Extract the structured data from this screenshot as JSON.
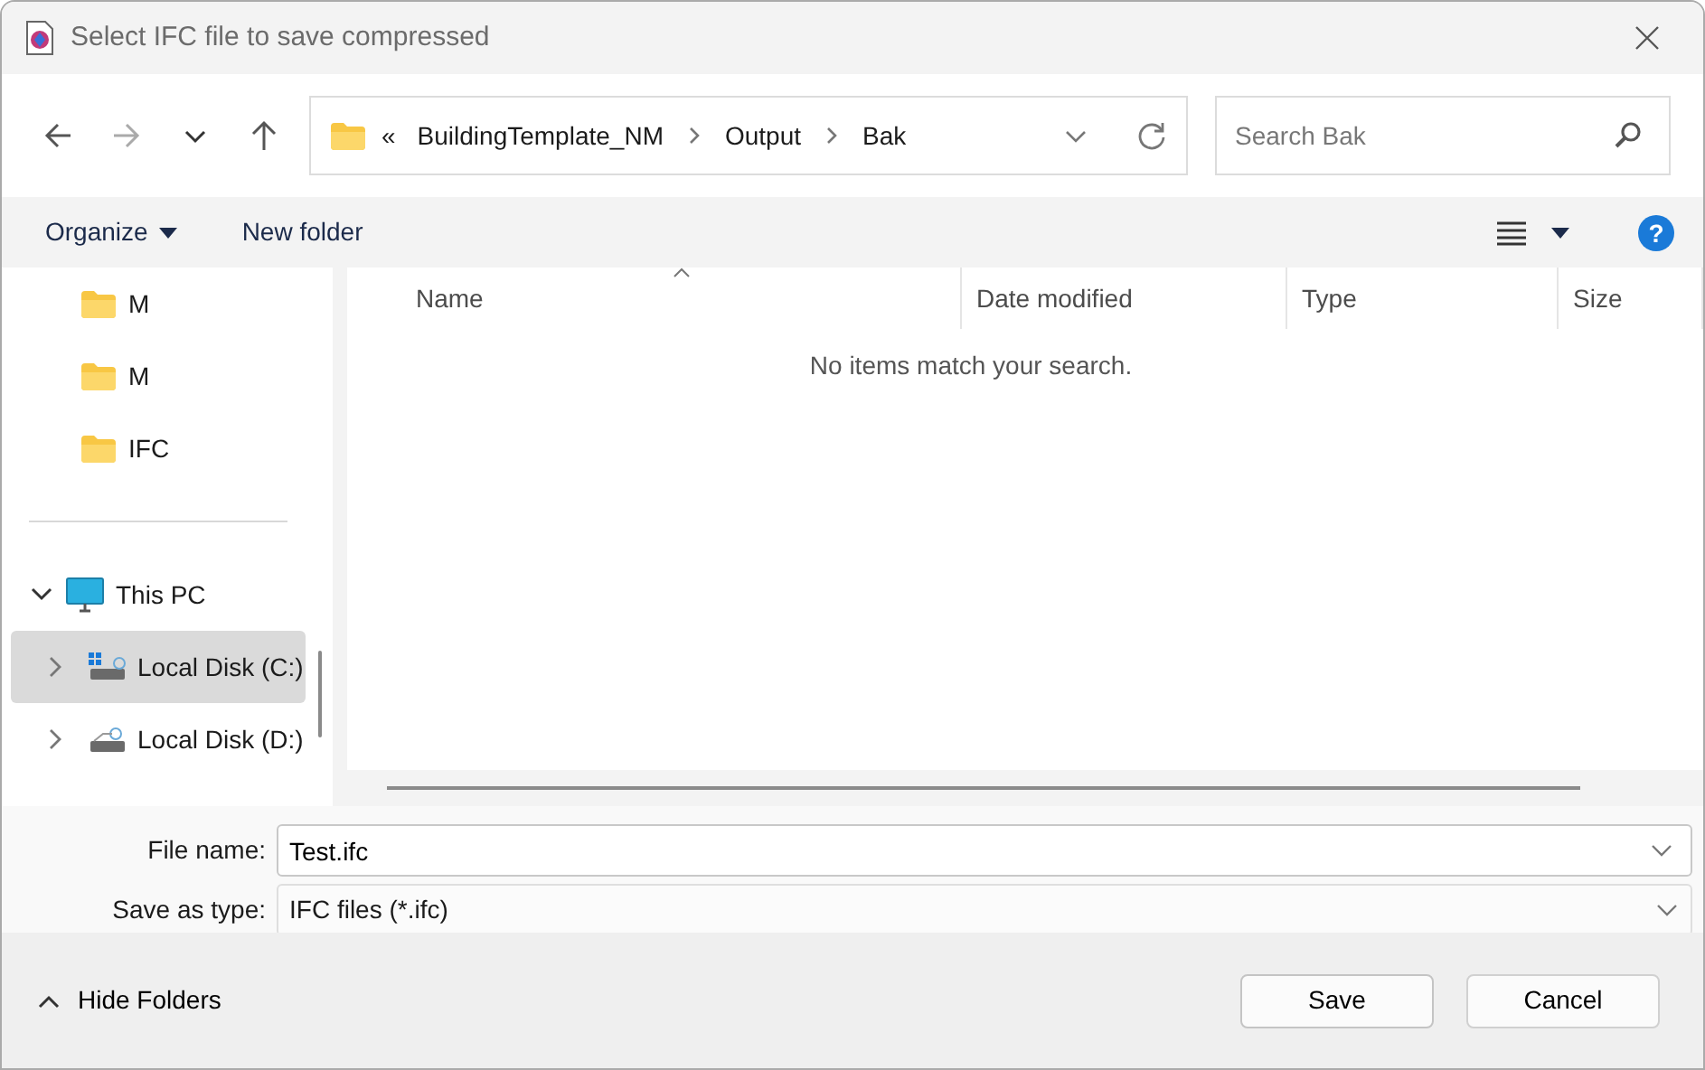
{
  "window": {
    "title": "Select IFC file to save compressed"
  },
  "navigation": {
    "back_enabled": true,
    "forward_enabled": false
  },
  "address": {
    "overflow": "«",
    "segments": [
      "BuildingTemplate_NM",
      "Output",
      "Bak"
    ]
  },
  "search": {
    "placeholder": "Search Bak"
  },
  "toolbar": {
    "organize": "Organize",
    "new_folder": "New folder",
    "help": "?"
  },
  "sidebar": {
    "items": [
      {
        "label": "M",
        "kind": "folder",
        "selected": false
      },
      {
        "label": "M",
        "kind": "folder",
        "selected": false
      },
      {
        "label": "IFC",
        "kind": "folder",
        "selected": false
      },
      {
        "label": "This PC",
        "kind": "pc",
        "selected": false,
        "expanded": true,
        "children": [
          {
            "label": "Local Disk (C:)",
            "kind": "system-drive",
            "selected": true,
            "expanded": false
          },
          {
            "label": "Local Disk (D:)",
            "kind": "drive",
            "selected": false,
            "expanded": false
          }
        ]
      }
    ]
  },
  "table": {
    "columns": [
      {
        "label": "Name",
        "sorted": true
      },
      {
        "label": "Date modified",
        "sorted": false
      },
      {
        "label": "Type",
        "sorted": false
      },
      {
        "label": "Size",
        "sorted": false
      }
    ],
    "empty_message": "No items match your search."
  },
  "form": {
    "file_name_label": "File name:",
    "file_name": "Test.ifc",
    "type_label": "Save as type:",
    "type": "IFC files (*.ifc)"
  },
  "footer": {
    "hide_folders": "Hide Folders",
    "buttons": [
      {
        "label": "Save",
        "kind": "primary"
      },
      {
        "label": "Cancel",
        "kind": "secondary"
      }
    ]
  }
}
